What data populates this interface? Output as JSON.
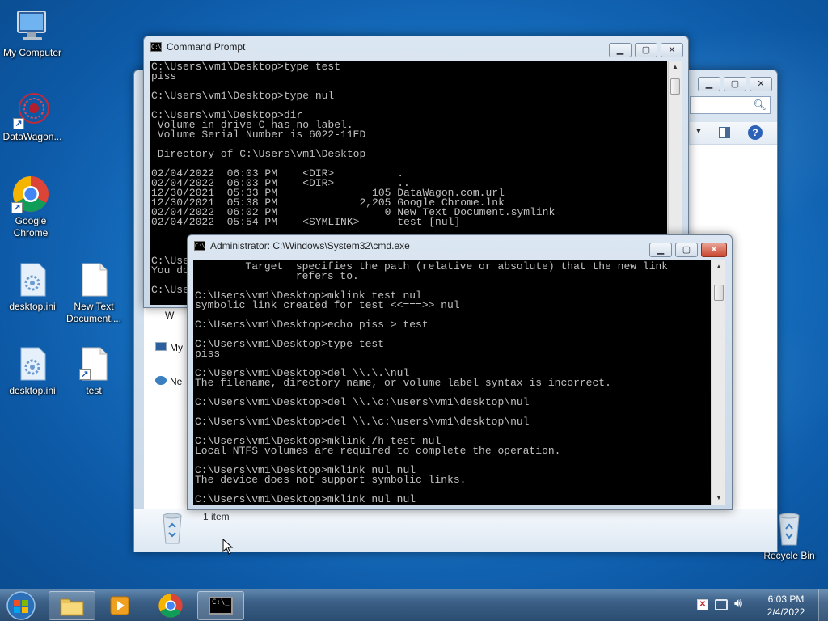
{
  "desktop": {
    "icons": [
      {
        "label": "My Computer",
        "icon": "computer-icon"
      },
      {
        "label": "DataWagon...",
        "icon": "datawagon-icon"
      },
      {
        "label": "Google Chrome",
        "icon": "chrome-icon"
      },
      {
        "label": "desktop.ini",
        "icon": "settings-file-icon"
      },
      {
        "label": "New Text Document....",
        "icon": "text-document-icon"
      },
      {
        "label": "desktop.ini",
        "icon": "settings-file-icon"
      },
      {
        "label": "test",
        "icon": "blank-file-shortcut-icon"
      },
      {
        "label": "Recycle Bin",
        "icon": "recycle-bin-icon"
      }
    ]
  },
  "explorer": {
    "sidebar_items": [
      "My",
      "Ne",
      "W"
    ],
    "status_count": "1 item"
  },
  "cmd_back": {
    "title": "Command Prompt",
    "lines": [
      "C:\\Users\\vm1\\Desktop>type test",
      "piss",
      "",
      "C:\\Users\\vm1\\Desktop>type nul",
      "",
      "C:\\Users\\vm1\\Desktop>dir",
      " Volume in drive C has no label.",
      " Volume Serial Number is 6022-11ED",
      "",
      " Directory of C:\\Users\\vm1\\Desktop",
      "",
      "02/04/2022  06:03 PM    <DIR>          .",
      "02/04/2022  06:03 PM    <DIR>          ..",
      "12/30/2021  05:33 PM               105 DataWagon.com.url",
      "12/30/2021  05:38 PM             2,205 Google Chrome.lnk",
      "02/04/2022  06:02 PM                 0 New Text Document.symlink",
      "02/04/2022  05:54 PM    <SYMLINK>      test [nul]",
      "",
      "",
      "",
      "C:\\Use",
      "You do",
      "",
      "C:\\Use"
    ]
  },
  "cmd_front": {
    "title": "Administrator: C:\\Windows\\System32\\cmd.exe",
    "lines": [
      "        Target  specifies the path (relative or absolute) that the new link",
      "                refers to.",
      "",
      "C:\\Users\\vm1\\Desktop>mklink test nul",
      "symbolic link created for test <<===>> nul",
      "",
      "C:\\Users\\vm1\\Desktop>echo piss > test",
      "",
      "C:\\Users\\vm1\\Desktop>type test",
      "piss",
      "",
      "C:\\Users\\vm1\\Desktop>del \\\\.\\.\\nul",
      "The filename, directory name, or volume label syntax is incorrect.",
      "",
      "C:\\Users\\vm1\\Desktop>del \\\\.\\c:\\users\\vm1\\desktop\\nul",
      "",
      "C:\\Users\\vm1\\Desktop>del \\\\.\\c:\\users\\vm1\\desktop\\nul",
      "",
      "C:\\Users\\vm1\\Desktop>mklink /h test nul",
      "Local NTFS volumes are required to complete the operation.",
      "",
      "C:\\Users\\vm1\\Desktop>mklink nul nul",
      "The device does not support symbolic links.",
      "",
      "C:\\Users\\vm1\\Desktop>mklink nul nul"
    ]
  },
  "taskbar": {
    "time": "6:03 PM",
    "date": "2/4/2022"
  },
  "colors": {
    "console_bg": "#000000",
    "console_fg": "#c0c0c0",
    "close_button": "#c9452e"
  }
}
